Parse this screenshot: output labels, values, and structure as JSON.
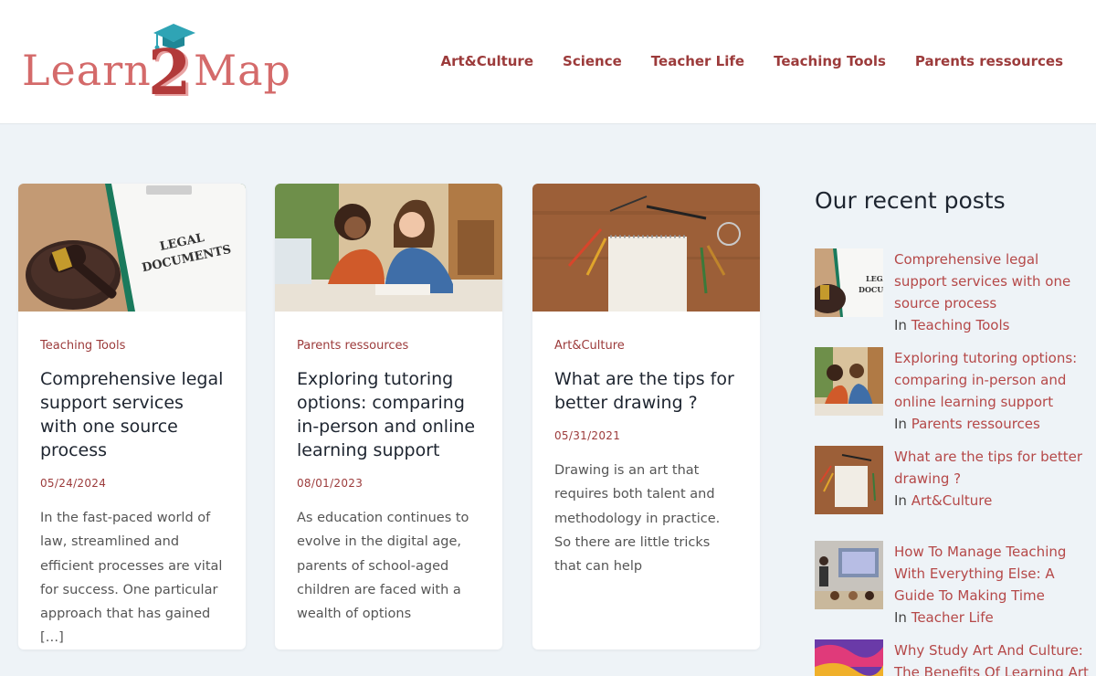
{
  "site": {
    "logo_left": "Learn",
    "logo_two": "2",
    "logo_right": "Map"
  },
  "nav": [
    {
      "label": "Art&Culture"
    },
    {
      "label": "Science"
    },
    {
      "label": "Teacher Life"
    },
    {
      "label": "Teaching Tools"
    },
    {
      "label": "Parents ressources"
    }
  ],
  "cards": [
    {
      "category": "Teaching Tools",
      "title": "Comprehensive legal support services with one source process",
      "date": "05/24/2024",
      "excerpt": "In the fast-paced world of law, streamlined and efficient processes are vital for success. One particular approach that has gained […]",
      "image_text": "LEGAL DOCUMENTS"
    },
    {
      "category": "Parents ressources",
      "title": "Exploring tutoring options: comparing in-person and online learning support",
      "date": "08/01/2023",
      "excerpt": "As education continues to evolve in the digital age, parents of school-aged children are faced with a wealth of options"
    },
    {
      "category": "Art&Culture",
      "title": "What are the tips for better drawing ?",
      "date": "05/31/2021",
      "excerpt": "Drawing is an art that requires both talent and methodology in practice. So there are little tricks that can help"
    }
  ],
  "sidebar": {
    "title": "Our recent posts",
    "in_label": "In",
    "posts": [
      {
        "title": "Comprehensive legal support services with one source process",
        "category": "Teaching Tools"
      },
      {
        "title": "Exploring tutoring options: comparing in-person and online learning support",
        "category": "Parents ressources"
      },
      {
        "title": "What are the tips for better drawing ?",
        "category": "Art&Culture"
      },
      {
        "title": "How To Manage Teaching With Everything Else: A Guide To Making Time",
        "category": "Teacher Life"
      },
      {
        "title": "Why Study Art And Culture: The Benefits Of Learning Art",
        "category": ""
      }
    ]
  },
  "colors": {
    "accent": "#9c3b3b",
    "link": "#b54848",
    "background": "#eef3f7",
    "heading": "#1e2530"
  }
}
